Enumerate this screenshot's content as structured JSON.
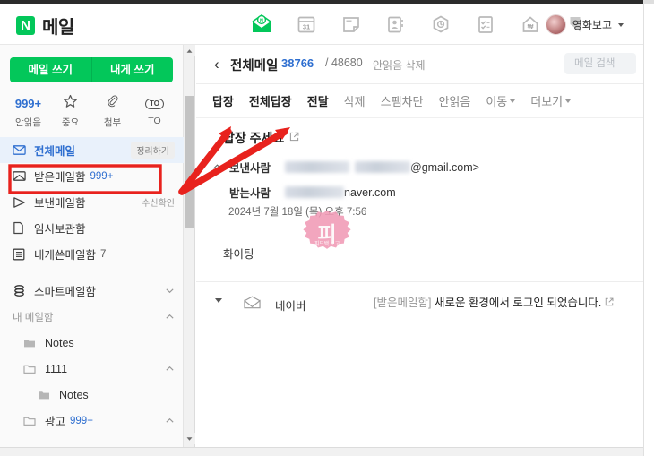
{
  "header": {
    "logo_mark": "N",
    "logo_text": "메일",
    "nav_icons": [
      {
        "name": "mail-icon",
        "label": "메일"
      },
      {
        "name": "calendar-icon",
        "label": "캘린더"
      },
      {
        "name": "memo-icon",
        "label": "메모"
      },
      {
        "name": "contacts-icon",
        "label": "주소록"
      },
      {
        "name": "drive-icon",
        "label": "MYBOX"
      },
      {
        "name": "todo-icon",
        "label": "할일"
      },
      {
        "name": "pay-icon",
        "label": "페이"
      },
      {
        "name": "bookmark-icon",
        "label": "북마크"
      }
    ],
    "profile_name": "영화보고"
  },
  "sidebar": {
    "compose_mail": "메일 쓰기",
    "compose_self": "내게 쓰기",
    "quick_filters": [
      {
        "name": "unread",
        "count": "999+",
        "label": "안읽음"
      },
      {
        "name": "important",
        "count": "",
        "label": "중요"
      },
      {
        "name": "attachment",
        "count": "",
        "label": "첨부"
      },
      {
        "name": "to",
        "count": "TO",
        "label": "TO"
      }
    ],
    "folders": [
      {
        "name": "all-mail",
        "label": "전체메일",
        "count": "",
        "tag": "정리하기",
        "active": true,
        "icon": "envelope-icon",
        "indent": 0
      },
      {
        "name": "inbox",
        "label": "받은메일함",
        "count": "999+",
        "tag": "",
        "active": false,
        "icon": "inbox-icon",
        "indent": 0
      },
      {
        "name": "sent",
        "label": "보낸메일함",
        "count": "",
        "tag": "수신확인",
        "active": false,
        "icon": "send-icon",
        "indent": 0
      },
      {
        "name": "drafts",
        "label": "임시보관함",
        "count": "",
        "tag": "",
        "active": false,
        "icon": "file-icon",
        "indent": 0
      },
      {
        "name": "self-mail",
        "label": "내게쓴메일함",
        "count_gray": "7",
        "tag": "",
        "active": false,
        "icon": "list-icon",
        "indent": 0
      },
      {
        "name": "smart-mail",
        "label": "스마트메일함",
        "count": "",
        "chevron": "down",
        "active": false,
        "icon": "smart-icon",
        "indent": 0
      },
      {
        "name": "my-folders",
        "label": "내 메일함",
        "count": "",
        "chevron": "up",
        "active": false,
        "icon": "none",
        "indent": 0,
        "group": true
      },
      {
        "name": "folder-notes",
        "label": "Notes",
        "count": "",
        "active": false,
        "icon": "folder-solid-icon",
        "indent": 1
      },
      {
        "name": "folder-1111",
        "label": "1111",
        "count": "",
        "chevron": "up",
        "active": false,
        "icon": "folder-icon",
        "indent": 1
      },
      {
        "name": "folder-notes-sub",
        "label": "Notes",
        "count": "",
        "active": false,
        "icon": "folder-solid-icon",
        "indent": 2
      },
      {
        "name": "folder-ads",
        "label": "광고",
        "count": "999+",
        "chevron": "up",
        "active": false,
        "icon": "folder-icon",
        "indent": 1
      }
    ]
  },
  "main": {
    "back_label": "‹",
    "title": "전체메일",
    "unread_count": "38766",
    "total_count": "/ 48680",
    "sub_actions": "안읽음 삭제",
    "search_placeholder": "메일 검색",
    "toolbar": [
      {
        "name": "reply",
        "label": "답장",
        "strong": true,
        "caret": false
      },
      {
        "name": "reply-all",
        "label": "전체답장",
        "strong": true,
        "caret": false
      },
      {
        "name": "forward",
        "label": "전달",
        "strong": true,
        "caret": false
      },
      {
        "name": "delete",
        "label": "삭제",
        "strong": false,
        "caret": false
      },
      {
        "name": "block-spam",
        "label": "스팸차단",
        "strong": false,
        "caret": false
      },
      {
        "name": "mark-unread",
        "label": "안읽음",
        "strong": false,
        "caret": false
      },
      {
        "name": "move",
        "label": "이동",
        "strong": false,
        "caret": true
      },
      {
        "name": "more",
        "label": "더보기",
        "strong": false,
        "caret": true
      }
    ],
    "message": {
      "subject": "답장 주세요",
      "sender_label": "보낸사람",
      "sender_suffix": "@gmail.com>",
      "recipient_label": "받는사람",
      "recipient_suffix": "naver.com",
      "date": "2024년 7월 18일 (목) 오후 7:56",
      "body": "화이팅"
    },
    "next_mail": {
      "sender": "네이버",
      "folder_tag": "[받은메일함]",
      "subject": "새로운 환경에서 로그인 되었습니다."
    }
  },
  "watermark": {
    "text": "피",
    "sub": "피드백 보고"
  },
  "colors": {
    "naver_green": "#03c75a",
    "accent_blue": "#2f6fd0",
    "annotation_red": "#e8221d",
    "watermark_pink": "#f09ab5"
  }
}
